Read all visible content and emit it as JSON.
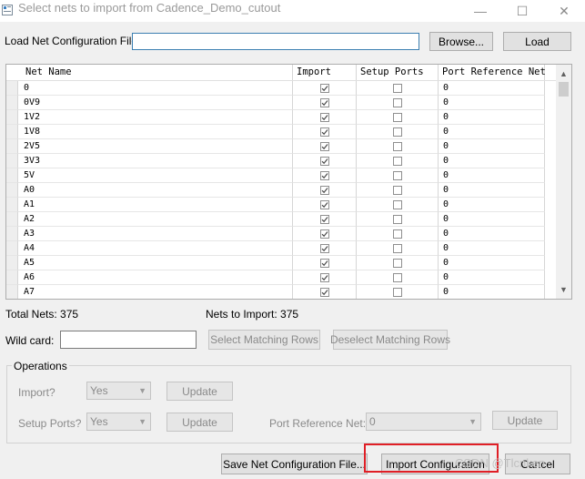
{
  "window": {
    "title": "Select nets to import from Cadence_Demo_cutout",
    "minimize_glyph": "—",
    "maximize_glyph": "☐",
    "close_glyph": "✕"
  },
  "load_config": {
    "label": "Load Net Configuration File",
    "path_value": "",
    "browse_label": "Browse...",
    "load_label": "Load"
  },
  "table": {
    "columns": [
      "Net Name",
      "Import",
      "Setup Ports",
      "Port Reference Net"
    ],
    "rows": [
      {
        "name": "0",
        "import": true,
        "setup": false,
        "ref": "0"
      },
      {
        "name": "0V9",
        "import": true,
        "setup": false,
        "ref": "0"
      },
      {
        "name": "1V2",
        "import": true,
        "setup": false,
        "ref": "0"
      },
      {
        "name": "1V8",
        "import": true,
        "setup": false,
        "ref": "0"
      },
      {
        "name": "2V5",
        "import": true,
        "setup": false,
        "ref": "0"
      },
      {
        "name": "3V3",
        "import": true,
        "setup": false,
        "ref": "0"
      },
      {
        "name": "5V",
        "import": true,
        "setup": false,
        "ref": "0"
      },
      {
        "name": "A0",
        "import": true,
        "setup": false,
        "ref": "0"
      },
      {
        "name": "A1",
        "import": true,
        "setup": false,
        "ref": "0"
      },
      {
        "name": "A2",
        "import": true,
        "setup": false,
        "ref": "0"
      },
      {
        "name": "A3",
        "import": true,
        "setup": false,
        "ref": "0"
      },
      {
        "name": "A4",
        "import": true,
        "setup": false,
        "ref": "0"
      },
      {
        "name": "A5",
        "import": true,
        "setup": false,
        "ref": "0"
      },
      {
        "name": "A6",
        "import": true,
        "setup": false,
        "ref": "0"
      },
      {
        "name": "A7",
        "import": true,
        "setup": false,
        "ref": "0"
      }
    ]
  },
  "summary": {
    "total_nets": "Total Nets: 375",
    "nets_to_import": "Nets to Import: 375"
  },
  "wildcard": {
    "label": "Wild card:",
    "value": "",
    "select_label": "Select Matching Rows",
    "deselect_label": "Deselect Matching Rows"
  },
  "operations": {
    "title": "Operations",
    "import_label": "Import?",
    "import_value": "Yes",
    "setup_label": "Setup Ports?",
    "setup_value": "Yes",
    "update_label": "Update",
    "port_ref_label": "Port Reference Net:",
    "port_ref_value": "0"
  },
  "footer": {
    "save_label": "Save Net Configuration File...",
    "import_label": "Import Configuration",
    "cancel_label": "Cancel"
  },
  "watermark": "CSDN @Tlcnken",
  "colors": {
    "highlight_box": "#e01f26",
    "check": "#4a4a4a"
  }
}
